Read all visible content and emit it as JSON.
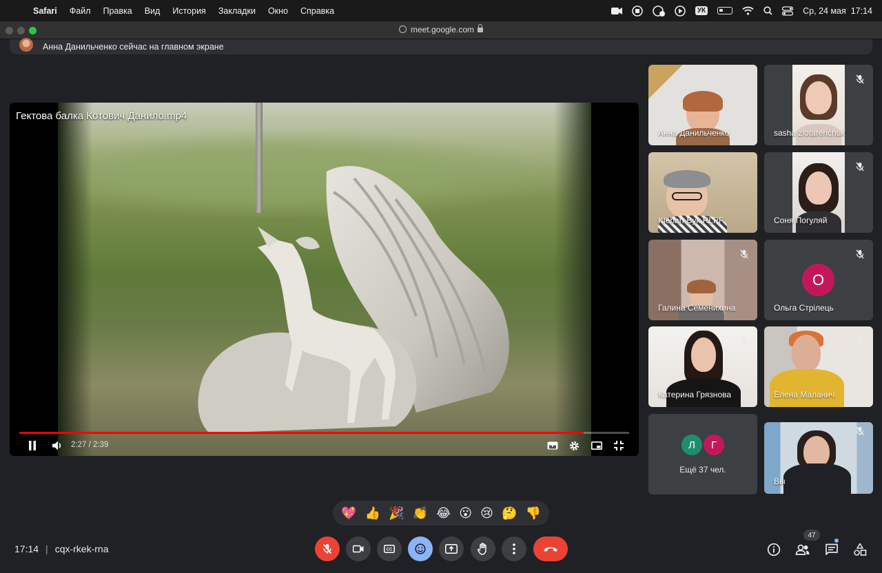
{
  "menubar": {
    "app": "Safari",
    "items": [
      "Файл",
      "Правка",
      "Вид",
      "История",
      "Закладки",
      "Окно",
      "Справка"
    ],
    "kbd_layout": "УК",
    "datetime": "Ср, 24 мая  17:14"
  },
  "browser": {
    "url": "meet.google.com"
  },
  "banner": {
    "text": "Анна Данильченко сейчас на главном экране"
  },
  "video": {
    "title": "Гектова балка Котович Данило.mp4",
    "time": "2:27 / 2:39",
    "progress": 0.925
  },
  "participants": [
    {
      "name": "Анна Данильченко",
      "muted": false
    },
    {
      "name": "sasha zlotarenchuk",
      "muted": true
    },
    {
      "name": "Kleban-Byk RLPF",
      "muted": false
    },
    {
      "name": "Соня Погуляй",
      "muted": true
    },
    {
      "name": "Галина Семенихина",
      "muted": true
    },
    {
      "name": "Ольга Стрілець",
      "muted": true,
      "initial": "О",
      "avatar_color": "#c2185b"
    },
    {
      "name": "Катерина Грязнова",
      "muted": true
    },
    {
      "name": "Елена Маланич",
      "muted": true
    },
    {
      "name": "Вы",
      "muted": true
    }
  ],
  "more": {
    "label": "Ещё 37 чел.",
    "avatars": [
      {
        "initial": "Л",
        "color": "#1e8e6e"
      },
      {
        "initial": "Г",
        "color": "#c2185b"
      }
    ]
  },
  "reactions": [
    "💖",
    "👍",
    "🎉",
    "👏",
    "😂",
    "😮",
    "😢",
    "🤔",
    "👎"
  ],
  "bottom": {
    "time": "17:14",
    "meeting_code": "cqx-rkek-rna",
    "participants_count": "47"
  },
  "colors": {
    "end_call": "#ea4335",
    "active_control": "#8ab4f8"
  }
}
